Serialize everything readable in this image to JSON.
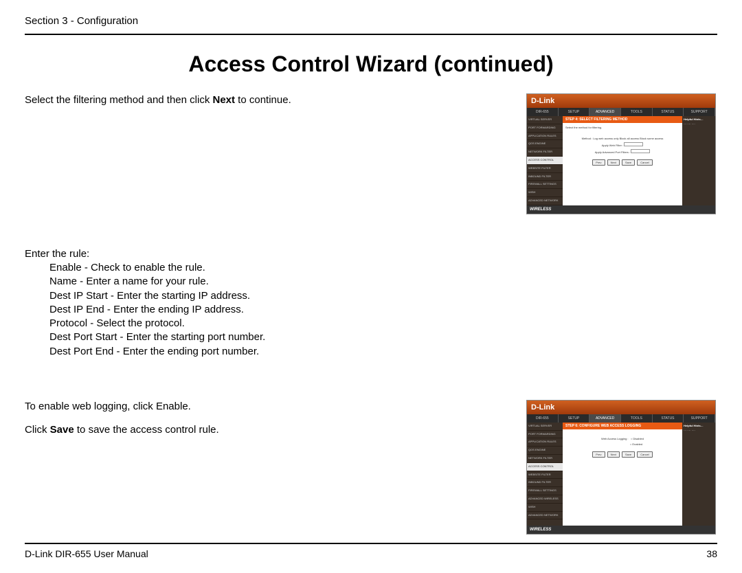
{
  "header": {
    "section": "Section 3 - Configuration"
  },
  "title": "Access Control Wizard (continued)",
  "block1": {
    "intro_pre": "Select the filtering method and then click ",
    "intro_bold": "Next",
    "intro_post": " to continue."
  },
  "block2": {
    "lead": "Enter the rule:",
    "items": {
      "enable": "Enable - Check to enable the rule.",
      "name": "Name - Enter a name for your rule.",
      "dip_start": "Dest IP Start - Enter the starting IP address.",
      "dip_end": "Dest IP End - Enter the ending IP address.",
      "protocol": "Protocol - Select the protocol.",
      "dport_start": "Dest Port Start - Enter the starting port number.",
      "dport_end": "Dest Port End - Enter the ending port number."
    }
  },
  "block3": {
    "line1": "To enable web logging, click Enable.",
    "line2_pre": "Click ",
    "line2_bold": "Save",
    "line2_post": " to save the access control rule."
  },
  "footer": {
    "left": "D-Link DIR-655 User Manual",
    "right": "38"
  },
  "shot": {
    "brand": "D-Link",
    "model": "DIR-655",
    "tabs": {
      "setup": "SETUP",
      "advanced": "ADVANCED",
      "tools": "TOOLS",
      "status": "STATUS",
      "support": "SUPPORT"
    },
    "side": {
      "virtual_server": "VIRTUAL SERVER",
      "port_forward": "PORT FORWARDING",
      "app_rules": "APPLICATION RULES",
      "qos": "QOS ENGINE",
      "net_filter": "NETWORK FILTER",
      "access_control": "ACCESS CONTROL",
      "website_filter": "WEBSITE FILTER",
      "inbound_filter": "INBOUND FILTER",
      "firewall": "FIREWALL SETTINGS",
      "adv_wireless": "ADVANCED WIRELESS",
      "wish": "WISH",
      "adv_network": "ADVANCED NETWORK"
    },
    "step4_title": "STEP 4: SELECT FILTERING METHOD",
    "step4_sub": "Select the method for filtering.",
    "method_label": "Method :",
    "method_opts": "Log web access only  Block all access  Block some access",
    "apply_web": "Apply Web Filter :",
    "apply_adv": "Apply Advanced Port Filters :",
    "btn_prev": "Prev",
    "btn_next": "Next",
    "btn_save": "Save",
    "btn_cancel": "Cancel",
    "helpful_hints": "Helpful Hints…",
    "wireless_footer": "WIRELESS",
    "step6_title": "STEP 6: CONFIGURE WEB ACCESS LOGGING",
    "web_logging_label": "Web Access Logging :",
    "opt_disabled": "Disabled",
    "opt_enabled": "Enabled"
  }
}
